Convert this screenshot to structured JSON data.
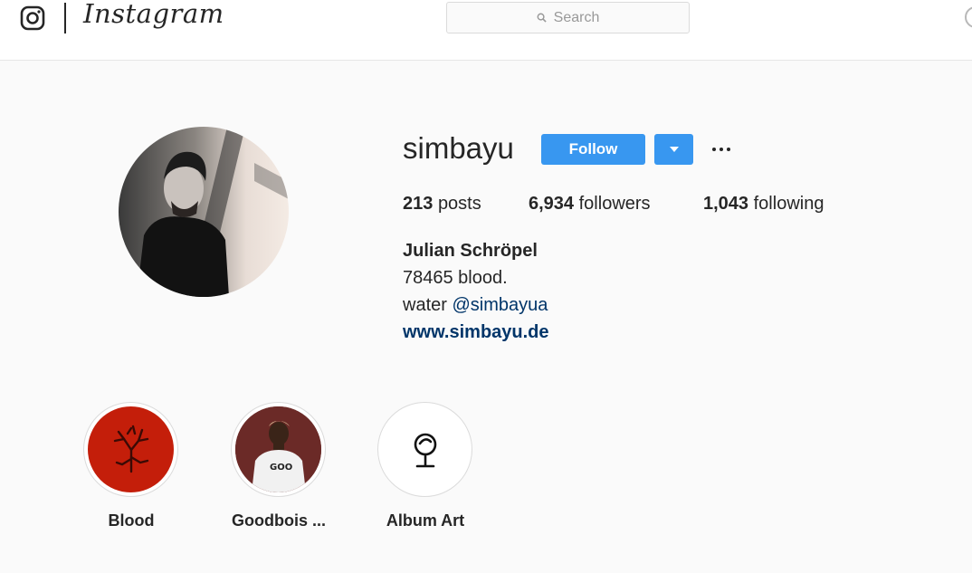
{
  "nav": {
    "wordmark": "Instagram",
    "search_placeholder": "Search"
  },
  "profile": {
    "username": "simbayu",
    "follow_label": "Follow",
    "stats": {
      "posts_count": "213",
      "posts_label": "posts",
      "followers_count": "6,934",
      "followers_label": "followers",
      "following_count": "1,043",
      "following_label": "following"
    },
    "full_name": "Julian Schröpel",
    "bio_line1": "78465 blood.",
    "bio_line2_prefix": "water ",
    "bio_line2_mention": "@simbayua",
    "website": "www.simbayu.de"
  },
  "highlights": [
    {
      "label": "Blood"
    },
    {
      "label": "Goodbois ..."
    },
    {
      "label": "Album Art"
    }
  ],
  "colors": {
    "accent": "#3897f0",
    "link": "#003569",
    "blood_highlight": "#c41e0a"
  }
}
